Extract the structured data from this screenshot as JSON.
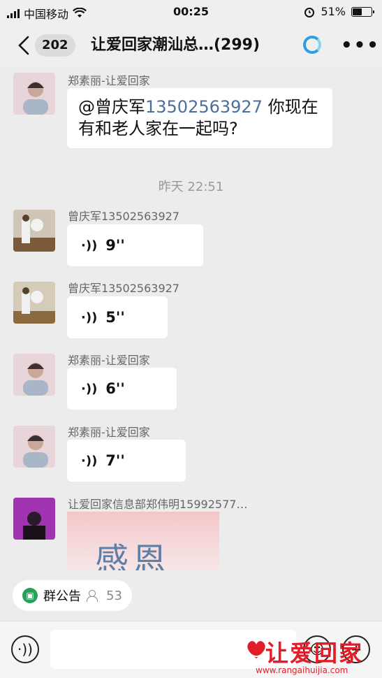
{
  "status_bar": {
    "carrier": "中国移动",
    "time": "00:25",
    "battery": "51%",
    "battery_level": 0.51
  },
  "nav": {
    "unread_count": "202",
    "title": "让爱回家潮汕总…(299)"
  },
  "messages": [
    {
      "sender": "郑素丽-让爱回家",
      "text_prefix": "@曾庆军",
      "text_phone": "13502563927",
      "text_line1_suffix": " 你现在",
      "text_line2": "有和老人家在一起吗?"
    },
    {
      "timestamp": "昨天 22:51"
    },
    {
      "sender": "曾庆军13502563927",
      "voice": "9''"
    },
    {
      "sender": "曾庆军13502563927",
      "voice": "5''"
    },
    {
      "sender": "郑素丽-让爱回家",
      "voice": "6''"
    },
    {
      "sender": "郑素丽-让爱回家",
      "voice": "7''"
    },
    {
      "sender": "让爱回家信息部郑伟明15992577…",
      "image_text": "感恩"
    }
  ],
  "announcement": {
    "label": "群公告",
    "members": "53"
  },
  "watermark": {
    "text": "让爱回家",
    "url": "www.rangaihuijia.com"
  },
  "colors": {
    "accent_blue": "#2b9fe0",
    "phone_link": "#4f6f9a",
    "watermark_red": "#e11d2a",
    "group_green": "#22a35a"
  }
}
